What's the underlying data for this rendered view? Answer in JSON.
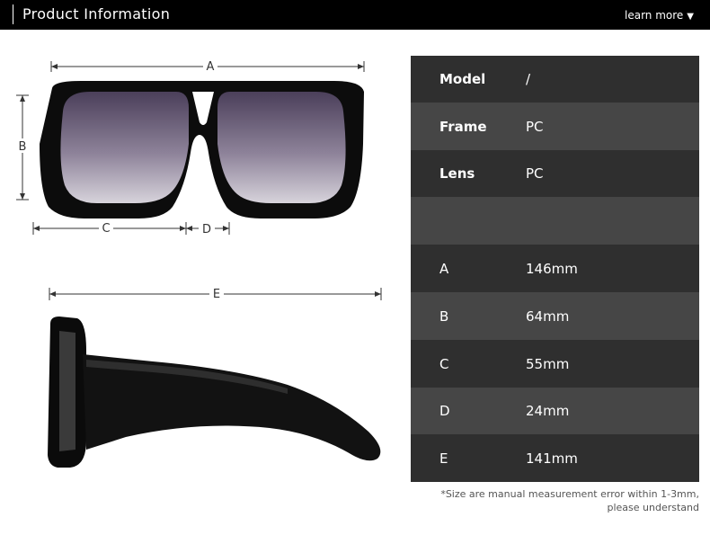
{
  "header": {
    "title": "Product Information",
    "learn_more": "learn more",
    "learn_more_icon": "triangle-down-icon"
  },
  "dimensions": {
    "a": "A",
    "b": "B",
    "c": "C",
    "d": "D",
    "e": "E"
  },
  "specs": [
    {
      "label": "Model",
      "value": "/"
    },
    {
      "label": "Frame",
      "value": "PC"
    },
    {
      "label": "Lens",
      "value": "PC"
    },
    {
      "label": "",
      "value": ""
    },
    {
      "label": "A",
      "value": "146mm"
    },
    {
      "label": "B",
      "value": "64mm"
    },
    {
      "label": "C",
      "value": "55mm"
    },
    {
      "label": "D",
      "value": "24mm"
    },
    {
      "label": "E",
      "value": "141mm"
    }
  ],
  "note": {
    "line1": "*Size are manual measurement error within 1-3mm,",
    "line2": "please understand"
  },
  "colors": {
    "header_bg": "#000000",
    "row_dark": "#2f2f2f",
    "row_light": "#464646"
  }
}
